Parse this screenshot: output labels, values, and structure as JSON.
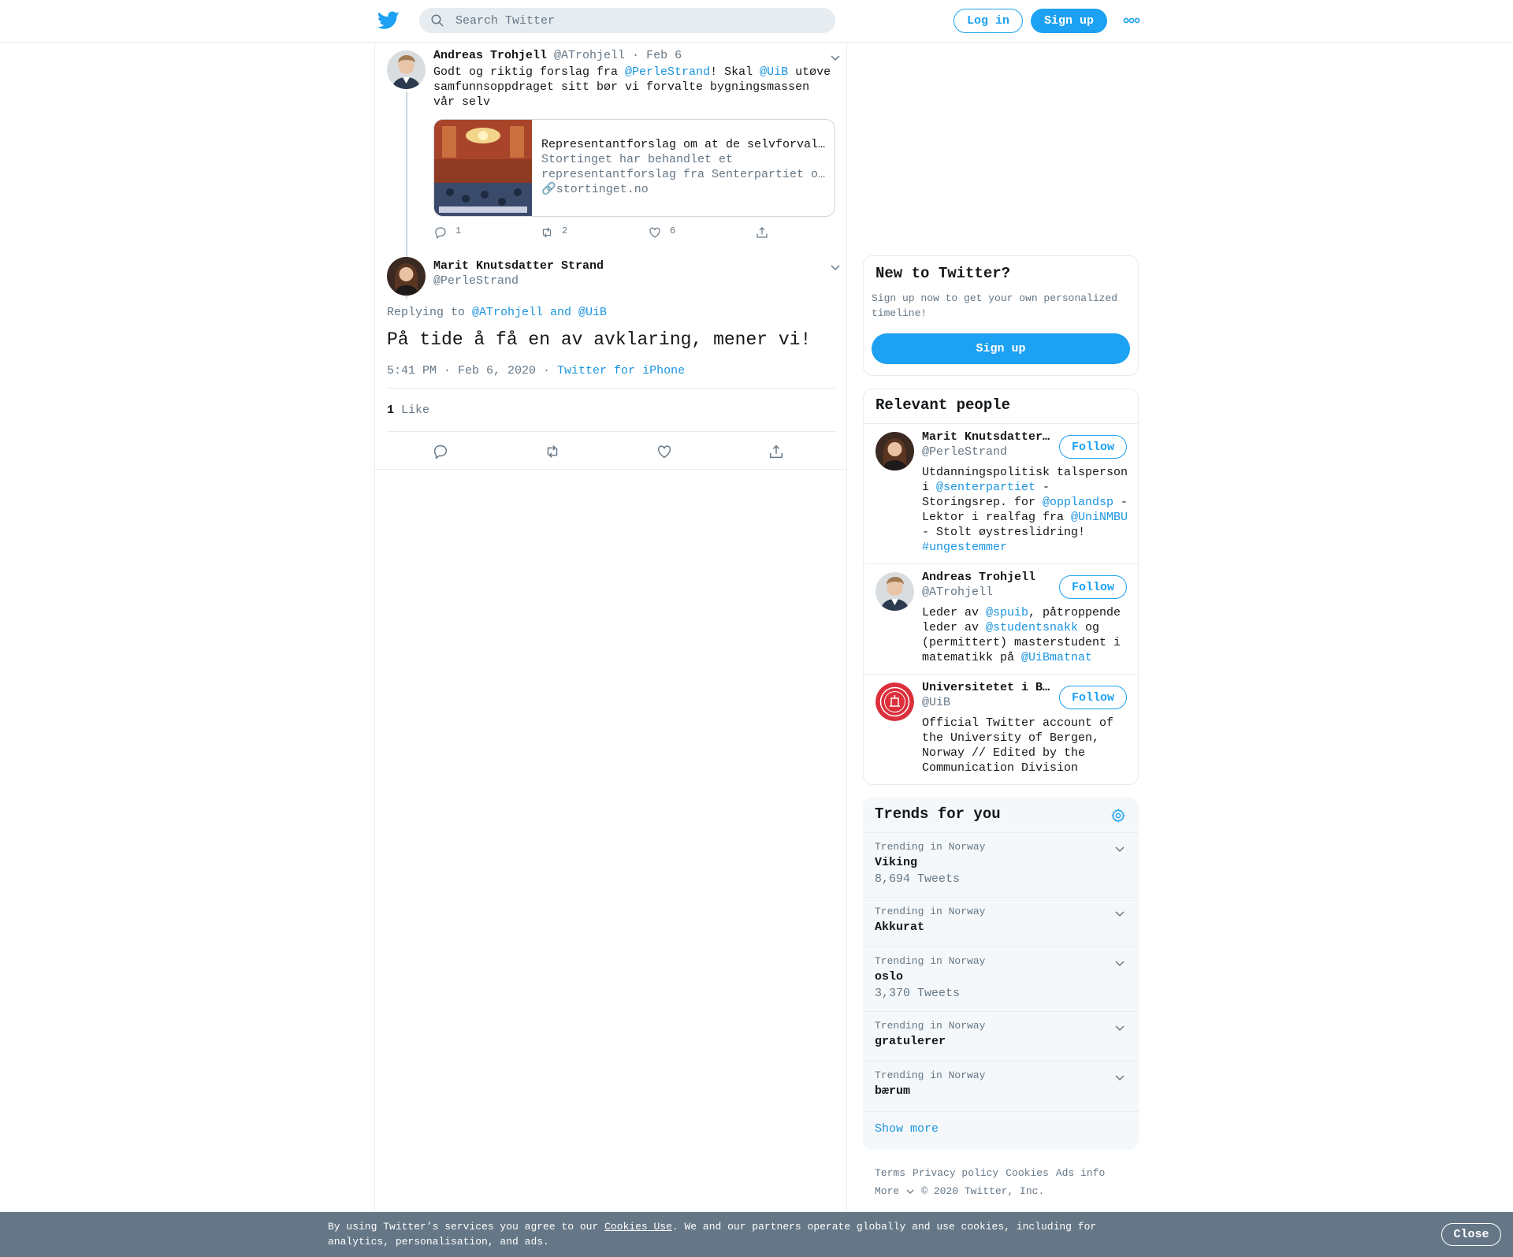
{
  "header": {
    "search_placeholder": "Search Twitter",
    "login_label": "Log in",
    "signup_label": "Sign up"
  },
  "thread": {
    "parent": {
      "name": "Andreas Trohjell",
      "handle": "@ATrohjell",
      "date": "Feb 6",
      "text_before": "Godt og riktig forslag fra ",
      "mention1": "@PerleStrand",
      "text_mid": "! Skal ",
      "mention2": "@UiB",
      "text_after": " utøve samfunnsoppdraget sitt bør vi forvalte bygningsmassen vår selv",
      "card": {
        "title": "Representantforslag om at de selvforvaltende",
        "description": "Stortinget har behandlet et representantforslag fra Senterpartiet om at de selvforvaltende",
        "domain": "stortinget.no"
      },
      "replies": "1",
      "retweets": "2",
      "likes": "6"
    },
    "main": {
      "name": "Marit Knutsdatter Strand",
      "handle": "@PerleStrand",
      "replying_label": "Replying to ",
      "replying_to": "@ATrohjell and @UiB",
      "text": "På tide å få en av avklaring, mener vi!",
      "time": "5:41 PM · Feb 6, 2020",
      "meta_sep": " · ",
      "source": "Twitter for iPhone",
      "like_count": "1",
      "like_label": "Like"
    }
  },
  "sidebar": {
    "new_to_twitter": {
      "title": "New to Twitter?",
      "description": "Sign up now to get your own personalized timeline!",
      "button": "Sign up"
    },
    "relevant_people": {
      "title": "Relevant people",
      "follow_label": "Follow",
      "people": [
        {
          "name": "Marit Knutsdatter Strand",
          "handle": "@PerleStrand",
          "bio_parts": [
            "Utdanningspolitisk talsperson i ",
            "@senterpartiet",
            " - Storingsrep. for ",
            "@opplandsp",
            " - Lektor i realfag fra ",
            "@UniNMBU",
            " - Stolt øystreslidring! ",
            "#ungestemmer"
          ]
        },
        {
          "name": "Andreas Trohjell",
          "handle": "@ATrohjell",
          "bio_parts": [
            "Leder av ",
            "@spuib",
            ", påtroppende leder av ",
            "@studentsnakk",
            " og (permittert) masterstudent i matematikk på ",
            "@UiBmatnat"
          ]
        },
        {
          "name": "Universitetet i Bergen",
          "handle": "@UiB",
          "bio": "Official Twitter account of the University of Bergen, Norway // Edited by the Communication Division"
        }
      ]
    },
    "trends": {
      "title": "Trends for you",
      "items": [
        {
          "context": "Trending in Norway",
          "name": "Viking",
          "count": "8,694 Tweets"
        },
        {
          "context": "Trending in Norway",
          "name": "Akkurat",
          "count": ""
        },
        {
          "context": "Trending in Norway",
          "name": "oslo",
          "count": "3,370 Tweets"
        },
        {
          "context": "Trending in Norway",
          "name": "gratulerer",
          "count": ""
        },
        {
          "context": "Trending in Norway",
          "name": "bærum",
          "count": ""
        }
      ],
      "show_more": "Show more"
    },
    "footer": {
      "links": [
        "Terms",
        "Privacy policy",
        "Cookies",
        "Ads info"
      ],
      "more": "More",
      "copyright": "© 2020 Twitter, Inc."
    }
  },
  "cookie_bar": {
    "text_before": "By using Twitter’s services you agree to our ",
    "link": "Cookies Use",
    "text_after": ". We and our partners operate globally and use cookies, including for analytics, personalisation, and ads.",
    "close": "Close"
  },
  "colors": {
    "brand": "#1da1f2",
    "link": "#1b95e0",
    "muted": "#657786",
    "border": "#e6ecf0",
    "cookie_bg": "#657786"
  }
}
